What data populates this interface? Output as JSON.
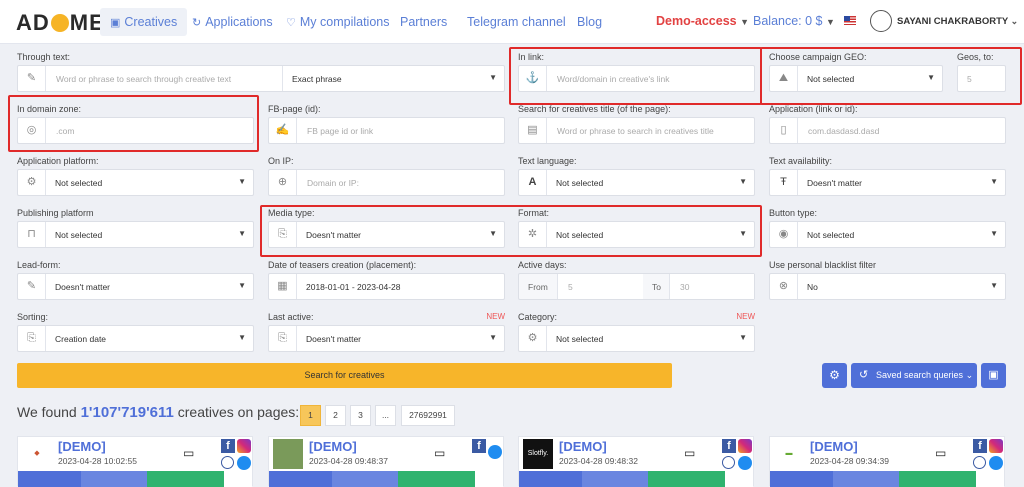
{
  "nav": {
    "logo": "AD ME",
    "items": [
      "Creatives",
      "Applications",
      "My compilations",
      "Partners",
      "Telegram channel",
      "Blog"
    ],
    "demo": "Demo-access",
    "balance": "Balance: 0 $",
    "user": "SAYANI CHAKRABORTY"
  },
  "filters": {
    "through_text": {
      "label": "Through text:",
      "placeholder": "Word or phrase to search through creative text",
      "mode": "Exact phrase"
    },
    "in_link": {
      "label": "In link:",
      "placeholder": "Word/domain in creative's link"
    },
    "geo": {
      "label": "Choose campaign GEO:",
      "value": "Not selected"
    },
    "geos_to": {
      "label": "Geos, to:",
      "value": "5"
    },
    "domain_zone": {
      "label": "In domain zone:",
      "placeholder": ".com"
    },
    "fb_page": {
      "label": "FB-page (id):",
      "placeholder": "FB page id or link"
    },
    "title": {
      "label": "Search for creatives title (of the page):",
      "placeholder": "Word or phrase to search in creatives title"
    },
    "application": {
      "label": "Application (link or id):",
      "placeholder": "com.dasdasd.dasd"
    },
    "app_platform": {
      "label": "Application platform:",
      "value": "Not selected"
    },
    "on_ip": {
      "label": "On IP:",
      "placeholder": "Domain or IP:"
    },
    "text_language": {
      "label": "Text language:",
      "value": "Not selected"
    },
    "text_availability": {
      "label": "Text availability:",
      "value": "Doesn't matter"
    },
    "publishing_platform": {
      "label": "Publishing platform",
      "value": "Not selected"
    },
    "media_type": {
      "label": "Media type:",
      "value": "Doesn't matter"
    },
    "format": {
      "label": "Format:",
      "value": "Not selected"
    },
    "button_type": {
      "label": "Button type:",
      "value": "Not selected"
    },
    "lead_form": {
      "label": "Lead-form:",
      "value": "Doesn't matter"
    },
    "teasers_date": {
      "label": "Date of teasers creation (placement):",
      "value": "2018-01-01 - 2023-04-28"
    },
    "active_days": {
      "label": "Active days:",
      "from_label": "From",
      "from": "5",
      "to_label": "To",
      "to": "30"
    },
    "blacklist": {
      "label": "Use personal blacklist filter",
      "value": "No"
    },
    "sorting": {
      "label": "Sorting:",
      "value": "Creation date"
    },
    "last_active": {
      "label": "Last active:",
      "badge": "NEW",
      "value": "Doesn't matter"
    },
    "category": {
      "label": "Category:",
      "badge": "NEW",
      "value": "Not selected"
    }
  },
  "actions": {
    "search": "Search for creatives",
    "saved": "Saved search queries"
  },
  "results": {
    "prefix": "We found",
    "count": "1'107'719'611",
    "suffix": "creatives on pages:"
  },
  "pagination": [
    "1",
    "2",
    "3",
    "...",
    "27692991"
  ],
  "cards": [
    {
      "title": "[DEMO]",
      "date": "2023-04-28 10:02:55",
      "thumb": "logo"
    },
    {
      "title": "[DEMO]",
      "date": "2023-04-28 09:48:37",
      "thumb": "photo"
    },
    {
      "title": "[DEMO]",
      "date": "2023-04-28 09:48:32",
      "thumb": "Slotfly."
    },
    {
      "title": "[DEMO]",
      "date": "2023-04-28 09:34:39",
      "thumb": "logo"
    }
  ]
}
